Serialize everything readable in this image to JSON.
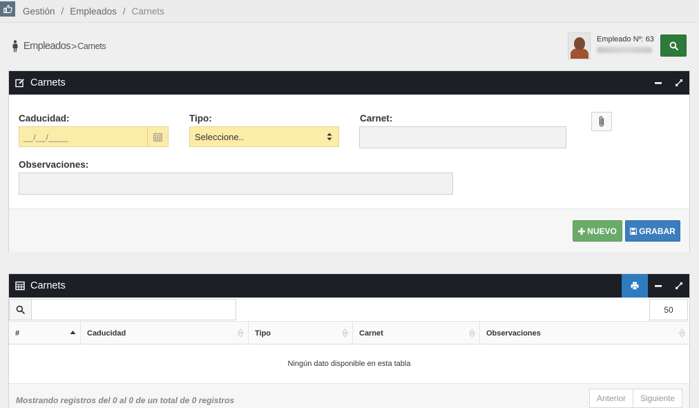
{
  "breadcrumb": {
    "items": [
      "Gestión",
      "Empleados",
      "Carnets"
    ],
    "separator": "/"
  },
  "page_header": {
    "section": "Empleados",
    "arrow": ">",
    "subsection": "Carnets"
  },
  "employee": {
    "label": "Empleado Nº: 63",
    "name_blurred": true
  },
  "form_panel": {
    "title": "Carnets",
    "fields": {
      "caducidad_label": "Caducidad:",
      "caducidad_placeholder": "__/__/____",
      "tipo_label": "Tipo:",
      "tipo_value": "Seleccione..",
      "carnet_label": "Carnet:",
      "carnet_value": "",
      "observaciones_label": "Observaciones:",
      "observaciones_value": ""
    },
    "buttons": {
      "nuevo": "NUEVO",
      "grabar": "GRABAR"
    }
  },
  "table_panel": {
    "title": "Carnets",
    "search_value": "",
    "page_length": "50",
    "columns": [
      "#",
      "Caducidad",
      "Tipo",
      "Carnet",
      "Observaciones"
    ],
    "empty_message": "Ningún dato disponible en esta tabla",
    "info": "Mostrando registros del 0 al 0 de un total de 0 registros",
    "pager": {
      "previous": "Anterior",
      "next": "Siguiente"
    }
  },
  "colors": {
    "panel_header": "#1c1f26",
    "required_field": "#fbeda8",
    "nuevo_button": "#6aab6a",
    "grabar_button": "#3c7ebd",
    "search_button": "#2e7a3a",
    "print_button": "#2f7bbf"
  },
  "icons": {
    "home": "hand-pointing-icon",
    "page_header": "person-icon",
    "employee_search": "search-icon",
    "form_panel": "edit-icon",
    "date": "calendar-icon",
    "select": "sort-arrows-icon",
    "attach": "paperclip-icon",
    "table_panel": "table-icon",
    "print": "print-icon",
    "minimize": "minus-icon",
    "expand": "expand-icon",
    "table_search": "search-icon"
  }
}
